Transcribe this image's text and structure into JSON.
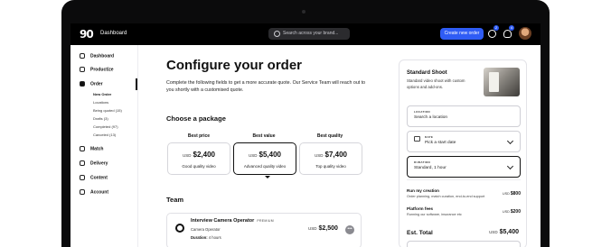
{
  "topbar": {
    "logo": "90",
    "breadcrumb": "Dashboard",
    "search_placeholder": "Search across your brand...",
    "new_order_label": "Create new order",
    "messages_badge": "2",
    "notifications_badge": "4"
  },
  "sidebar": {
    "items": [
      {
        "label": "Dashboard",
        "icon": "home-icon"
      },
      {
        "label": "Productize",
        "icon": "box-icon"
      },
      {
        "label": "Order",
        "icon": "order-icon"
      },
      {
        "label": "Match",
        "icon": "users-icon"
      },
      {
        "label": "Delivery",
        "icon": "video-icon"
      },
      {
        "label": "Content",
        "icon": "folder-icon"
      },
      {
        "label": "Account",
        "icon": "account-icon"
      }
    ],
    "order_subitems": [
      "New Order",
      "Locations",
      "Being quoted (15)",
      "Drafts (3)",
      "Completed (97)",
      "Canceled (13)"
    ]
  },
  "main": {
    "title": "Configure your order",
    "intro": "Complete the following fields to get a more accurate quote. Our Service Team will reach out to you shortly with a customised quote.",
    "package_heading": "Choose a package",
    "packages": [
      {
        "tier": "Best price",
        "currency": "USD",
        "price": "$2,400",
        "desc": "Good quality video"
      },
      {
        "tier": "Best value",
        "currency": "USD",
        "price": "$5,400",
        "desc": "Advanced quality video"
      },
      {
        "tier": "Best quality",
        "currency": "USD",
        "price": "$7,400",
        "desc": "Top quality video"
      }
    ],
    "team_heading": "Team",
    "team": [
      {
        "title": "Interview Camera Operator",
        "tag": "PREMIUM",
        "role": "Camera Operator",
        "duration_label": "Duration:",
        "duration": "4 hours",
        "currency": "USD",
        "price": "$2,500",
        "more": "•••"
      }
    ]
  },
  "summary": {
    "title": "Standard Shoot",
    "desc": "Standard video shoot with custom options and add-ons.",
    "location_label": "LOCATION",
    "location_value": "Search a location",
    "date_label": "DATE",
    "date_value": "Pick a start date",
    "duration_label": "DURATION",
    "duration_value": "Standard, 1 hour",
    "fees": [
      {
        "title": "Run my creation",
        "sub": "Order planning, match curation, end-to-end support",
        "currency": "USD",
        "price": "$800"
      },
      {
        "title": "Platform fees",
        "sub": "Running our software, insurance etc",
        "currency": "USD",
        "price": "$200"
      }
    ],
    "total_label": "Est. Total",
    "total_currency": "USD",
    "total_price": "$5,400"
  },
  "colors": {
    "accent": "#2f5cf5",
    "ink": "#111111",
    "bezel": "#0b0b0c"
  }
}
